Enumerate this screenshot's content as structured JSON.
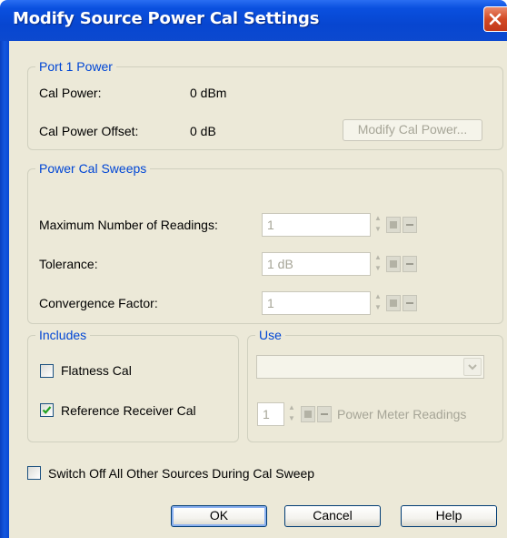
{
  "window": {
    "title": "Modify Source Power Cal Settings"
  },
  "port1": {
    "legend": "Port 1 Power",
    "cal_power_label": "Cal Power:",
    "cal_power_value": "0 dBm",
    "offset_label": "Cal Power Offset:",
    "offset_value": "0 dB",
    "modify_button": "Modify Cal Power..."
  },
  "sweeps": {
    "legend": "Power Cal Sweeps",
    "max_readings_label": "Maximum Number of Readings:",
    "max_readings_value": "1",
    "tolerance_label": "Tolerance:",
    "tolerance_value": "1 dB",
    "convergence_label": "Convergence Factor:",
    "convergence_value": "1"
  },
  "includes": {
    "legend": "Includes",
    "flatness_label": "Flatness Cal",
    "flatness_checked": false,
    "reference_label": "Reference Receiver Cal",
    "reference_checked": true
  },
  "use": {
    "legend": "Use",
    "combo_value": "",
    "readings_value": "1",
    "readings_label": "Power Meter Readings"
  },
  "switch_off": {
    "label": "Switch Off All Other Sources During Cal Sweep",
    "checked": false
  },
  "buttons": {
    "ok": "OK",
    "cancel": "Cancel",
    "help": "Help"
  },
  "icons": {
    "close": "close-icon",
    "check": "checkmark-icon",
    "spin": "spin-arrows-icon",
    "star": "add-star-icon",
    "minus": "minus-icon",
    "dropdown": "chevron-down-icon"
  },
  "colors": {
    "title_bar": "#0746d0",
    "legend_text": "#0046d5",
    "dialog_bg": "#ece9d8",
    "close_button": "#d24a24"
  }
}
